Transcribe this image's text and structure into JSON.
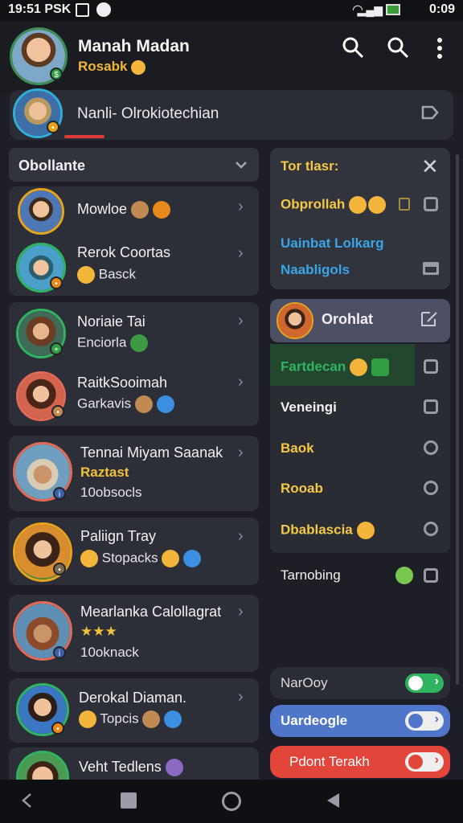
{
  "status": {
    "time": "19:51",
    "carrier": "PSK",
    "battery": "0:09"
  },
  "header": {
    "name": "Manah Madan",
    "subtitle": "Rosabk"
  },
  "search": {
    "text": "Nanli- Olrokiotechian"
  },
  "left_dropdown": {
    "label": "Obollante"
  },
  "contacts": [
    {
      "name": "Mowloe",
      "sub": ""
    },
    {
      "name": "Rerok Coortas",
      "sub": "Basck"
    },
    {
      "name": "Noriaie Tai",
      "sub": "Enciorla"
    },
    {
      "name": "RaitkSooimah",
      "sub": "Garkavis"
    },
    {
      "name": "Tennai Miyam Saanak",
      "accent": "Raztast",
      "sub": "10obsocls"
    },
    {
      "name": "Paliign Tray",
      "sub": "Stopacks"
    },
    {
      "name": "Mearlanka Calollagrat",
      "sub": "10oknack"
    },
    {
      "name": "Derokal Diaman.",
      "sub": "Topcis"
    },
    {
      "name": "Veht Tedlens",
      "sub": ""
    }
  ],
  "right_panel": {
    "title": "Tor tlasr:",
    "item1": "Obprollah",
    "item2": "Uainbat Lolkarg",
    "item3": "Naabligols"
  },
  "contact_pill": {
    "label": "Orohlat"
  },
  "menu": [
    {
      "label": "Fartdecan",
      "color": "#2fb560"
    },
    {
      "label": "Veneingi",
      "color": "#f1f1f1"
    },
    {
      "label": "Baok",
      "color": "#f5c845"
    },
    {
      "label": "Rooab",
      "color": "#f5c845"
    },
    {
      "label": "Dbablascia",
      "color": "#f5c845"
    }
  ],
  "tarnobing": {
    "label": "Tarnobing"
  },
  "toggles": [
    {
      "label": "NarOoy",
      "bg": "#2b2d36",
      "color": "#dcdcdc"
    },
    {
      "label": "Uardeogle",
      "bg": "#4f76c9",
      "color": "#ffffff"
    },
    {
      "label": "Pdont Terakh",
      "bg": "#e2453a",
      "color": "#ffffff"
    }
  ],
  "colors": {
    "accent": "#f3c13b",
    "blue": "#3aa5e6",
    "red": "#e2453a",
    "green": "#2fb560"
  }
}
